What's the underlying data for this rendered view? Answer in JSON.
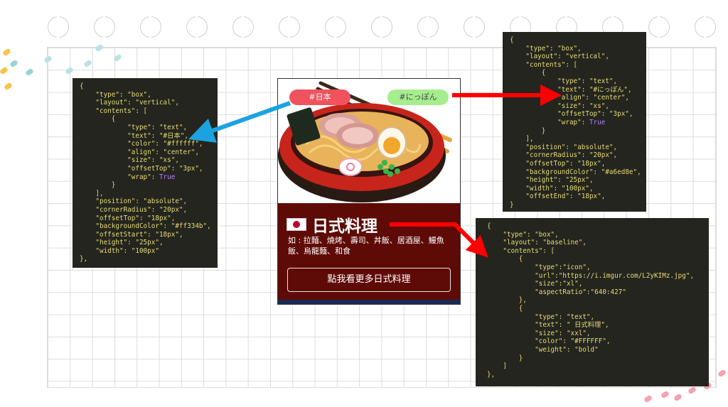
{
  "colors": {
    "tag_japan_bg": "#f0525e",
    "tag_nippon_bg": "#a6ed8e",
    "card_bg": "#5e0b07",
    "arrow_blue": "#1aa3e0",
    "arrow_red": "#ff0000"
  },
  "tags": {
    "japan": "#日本",
    "nippon": "#にっぽん"
  },
  "card": {
    "title": "日式料理",
    "description": "如 : 拉麵、燒烤、壽司、丼飯、居酒屋、鰻魚飯、烏龍麵、和食",
    "button_label": "點我看更多日式料理"
  },
  "icons": {
    "flag": "japan-flag-icon",
    "hero": "ramen-bowl-image"
  },
  "code_left": [
    "{",
    "    \"type\": \"box\",",
    "    \"layout\": \"vertical\",",
    "    \"contents\": [",
    "        {",
    "            \"type\": \"text\",",
    "            \"text\": \"#日本\",",
    "            \"color\": \"#ffffff\",",
    "            \"align\": \"center\",",
    "            \"size\": \"xs\",",
    "            \"offsetTop\": \"3px\",",
    "            \"wrap\": True",
    "        }",
    "    ],",
    "    \"position\": \"absolute\",",
    "    \"cornerRadius\": \"20px\",",
    "    \"offsetTop\": \"18px\",",
    "    \"backgroundColor\": \"#ff334b\",",
    "    \"offsetStart\": \"18px\",",
    "    \"height\": \"25px\",",
    "    \"width\": \"100px\"",
    "},"
  ],
  "code_right_top": [
    "{",
    "    \"type\": \"box\",",
    "    \"layout\": \"vertical\",",
    "    \"contents\": [",
    "        {",
    "            \"type\": \"text\",",
    "            \"text\": \"#にっぽん\",",
    "            \"align\": \"center\",",
    "            \"size\": \"xs\",",
    "            \"offsetTop\": \"3px\",",
    "            \"wrap\": True",
    "        }",
    "    ],",
    "    \"position\": \"absolute\",",
    "    \"cornerRadius\": \"20px\",",
    "    \"offsetTop\": \"18px\",",
    "    \"backgroundColor\": \"#a6ed8e\",",
    "    \"height\": \"25px\",",
    "    \"width\": \"100px\",",
    "    \"offsetEnd\": \"18px\",",
    "}"
  ],
  "code_right_bottom": [
    "{",
    "    \"type\": \"box\",",
    "    \"layout\": \"baseline\",",
    "    \"contents\": [",
    "        {",
    "            \"type\":\"icon\",",
    "            \"url\":\"https://i.imgur.com/L2yKIMz.jpg\",",
    "            \"size\":\"xl\",",
    "            \"aspectRatio\":\"640:427\"",
    "        },",
    "        {",
    "            \"type\": \"text\",",
    "            \"text\": \" 日式料理\",",
    "            \"size\": \"xxl\",",
    "            \"color\": \"#FFFFFF\",",
    "            \"weight\": \"bold\"",
    "        }",
    "    ]",
    "},"
  ]
}
